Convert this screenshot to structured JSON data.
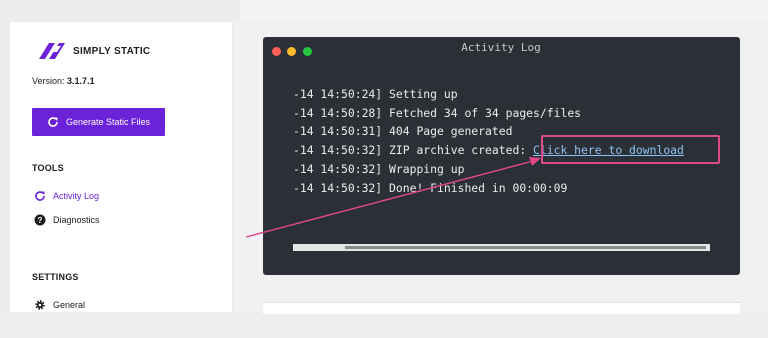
{
  "sidebar": {
    "logo_text": "Simply Static",
    "version_label": "Version:",
    "version_value": "3.1.7.1",
    "generate_button": "Generate Static Files",
    "tools_heading": "TOOLS",
    "tools_items": [
      {
        "label": "Activity Log",
        "icon": "refresh-icon",
        "active": true
      },
      {
        "label": "Diagnostics",
        "icon": "help-circle-icon",
        "active": false
      }
    ],
    "settings_heading": "SETTINGS",
    "settings_items": [
      {
        "label": "General",
        "icon": "gear-icon"
      }
    ]
  },
  "terminal": {
    "title": "Activity Log",
    "lines": [
      {
        "timestamp": "-14 14:50:24]",
        "message": "Setting up"
      },
      {
        "timestamp": "-14 14:50:28]",
        "message": "Fetched 34 of 34 pages/files"
      },
      {
        "timestamp": "-14 14:50:31]",
        "message": "404 Page generated"
      },
      {
        "timestamp": "-14 14:50:32]",
        "message": "ZIP archive created:",
        "link": "Click here to download"
      },
      {
        "timestamp": "-14 14:50:32]",
        "message": "Wrapping up"
      },
      {
        "timestamp": "-14 14:50:32]",
        "message": "Done! Finished in 00:00:09"
      }
    ],
    "progress_percent": 100
  },
  "colors": {
    "accent": "#6b22d8",
    "terminal_bg": "#2b2f36",
    "highlight": "#e0488a",
    "link": "#8ec1f4"
  }
}
